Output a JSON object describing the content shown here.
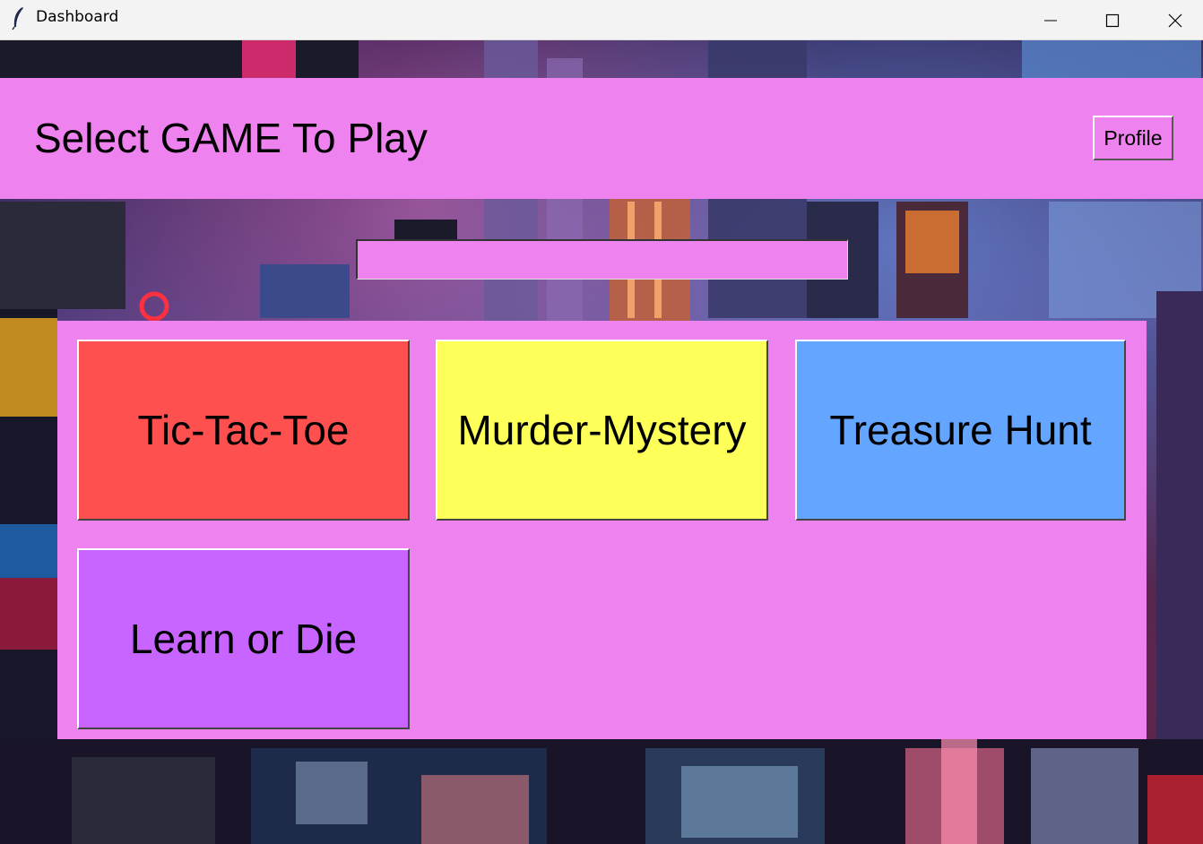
{
  "window": {
    "title": "Dashboard",
    "icon": "feather-icon",
    "controls": [
      "minimize-icon",
      "maximize-icon",
      "close-icon"
    ]
  },
  "header": {
    "title": "Select GAME To Play",
    "profile_label": "Profile",
    "background": "#ee82ee"
  },
  "search": {
    "value": "",
    "placeholder": ""
  },
  "games": [
    {
      "label": "Tic-Tac-Toe",
      "color": "#ff5050"
    },
    {
      "label": "Murder-Mystery",
      "color": "#ffff5a"
    },
    {
      "label": "Treasure Hunt",
      "color": "#64a5ff"
    },
    {
      "label": "Learn or Die",
      "color": "#c864ff"
    }
  ]
}
